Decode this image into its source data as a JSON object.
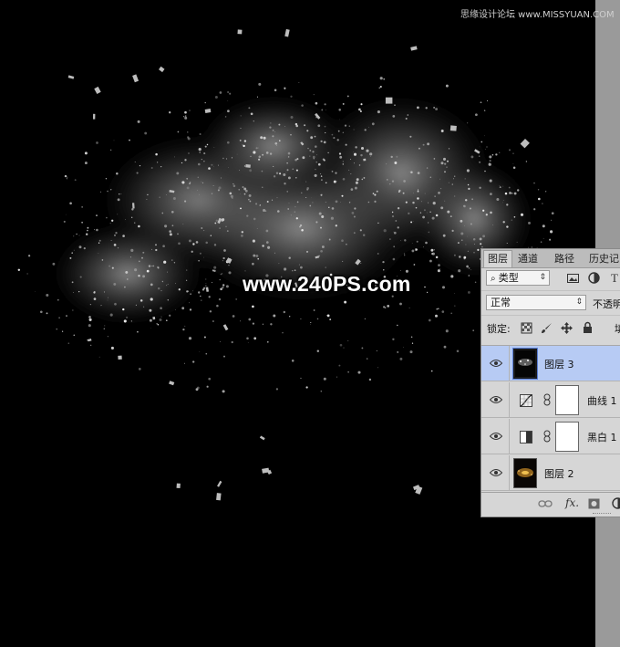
{
  "watermark": {
    "top": "思缘设计论坛 www.MISSYUAN.COM",
    "center": "www.240PS.com"
  },
  "panel": {
    "tabs": [
      "图层",
      "通道",
      "路径",
      "历史记"
    ],
    "filter_kind": "类型",
    "blend_mode": "正常",
    "opacity_label": "不透明",
    "lock_label": "锁定:",
    "fill_label_partial": "填",
    "layers": [
      {
        "name": "图层 3",
        "type": "pixel",
        "selected": true
      },
      {
        "name": "曲线 1",
        "type": "curves-adjustment",
        "selected": false
      },
      {
        "name": "黑白 1",
        "type": "black-white-adjustment",
        "selected": false
      },
      {
        "name": "图层 2",
        "type": "pixel",
        "selected": false
      }
    ],
    "bottom_icons": [
      "link-icon",
      "fx-icon",
      "mask-icon",
      "adjustment-icon"
    ],
    "fx_label": "fx."
  },
  "colors": {
    "canvas_bg": "#000000",
    "panel_bg": "#d6d6d6",
    "selected_row": "#b7cbf4",
    "scrollbar": "#9a9a9a"
  }
}
